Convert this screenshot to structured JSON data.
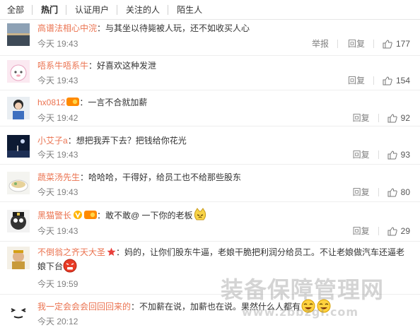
{
  "tabs": [
    "全部",
    "热门",
    "认证用户",
    "关注的人",
    "陌生人"
  ],
  "active_tab": "热门",
  "labels": {
    "report": "举报",
    "reply": "回复"
  },
  "comments": [
    {
      "user": "高谱法相心中浣",
      "text": "：与其坐以待毙被人玩，还不如收买人心",
      "time": "今天 19:43",
      "likes": "177",
      "show_report": true
    },
    {
      "user": "唔系牛唔系牛",
      "text": "：好喜欢这种发泄",
      "time": "今天 19:43",
      "likes": "154"
    },
    {
      "user": "hx0812",
      "text": "：一言不合就加薪",
      "time": "今天 19:42",
      "likes": "92"
    },
    {
      "user": "小艾子a",
      "text": "：想把我弄下去？把钱给你花光",
      "time": "今天 19:43",
      "likes": "93"
    },
    {
      "user": "蔬菜汤先生",
      "text": "：哈哈哈，干得好，给员工也不给那些股东",
      "time": "今天 19:43",
      "likes": "80"
    },
    {
      "user": "黑猫警长",
      "text": "：敢不敢@ 一下你的老板",
      "time": "今天 19:43",
      "likes": "29"
    },
    {
      "user": "不倒翁之齐天大圣",
      "text": "：妈的，让你们股东牛逼，老娘干脆把利润分给员工。不让老娘做汽车还逼老娘下台",
      "time": "今天 19:59",
      "likes": ""
    },
    {
      "user": "我一定会会会回回回来的",
      "text": "：不加薪在说，加薪也在说。果然什么人都有",
      "time": "今天 20:12",
      "likes": ""
    }
  ],
  "watermark": "装备保障管理网",
  "watermark_url": "www.zbbzgl.com",
  "colors": {
    "username": "#eb7350",
    "meta": "#808080"
  }
}
